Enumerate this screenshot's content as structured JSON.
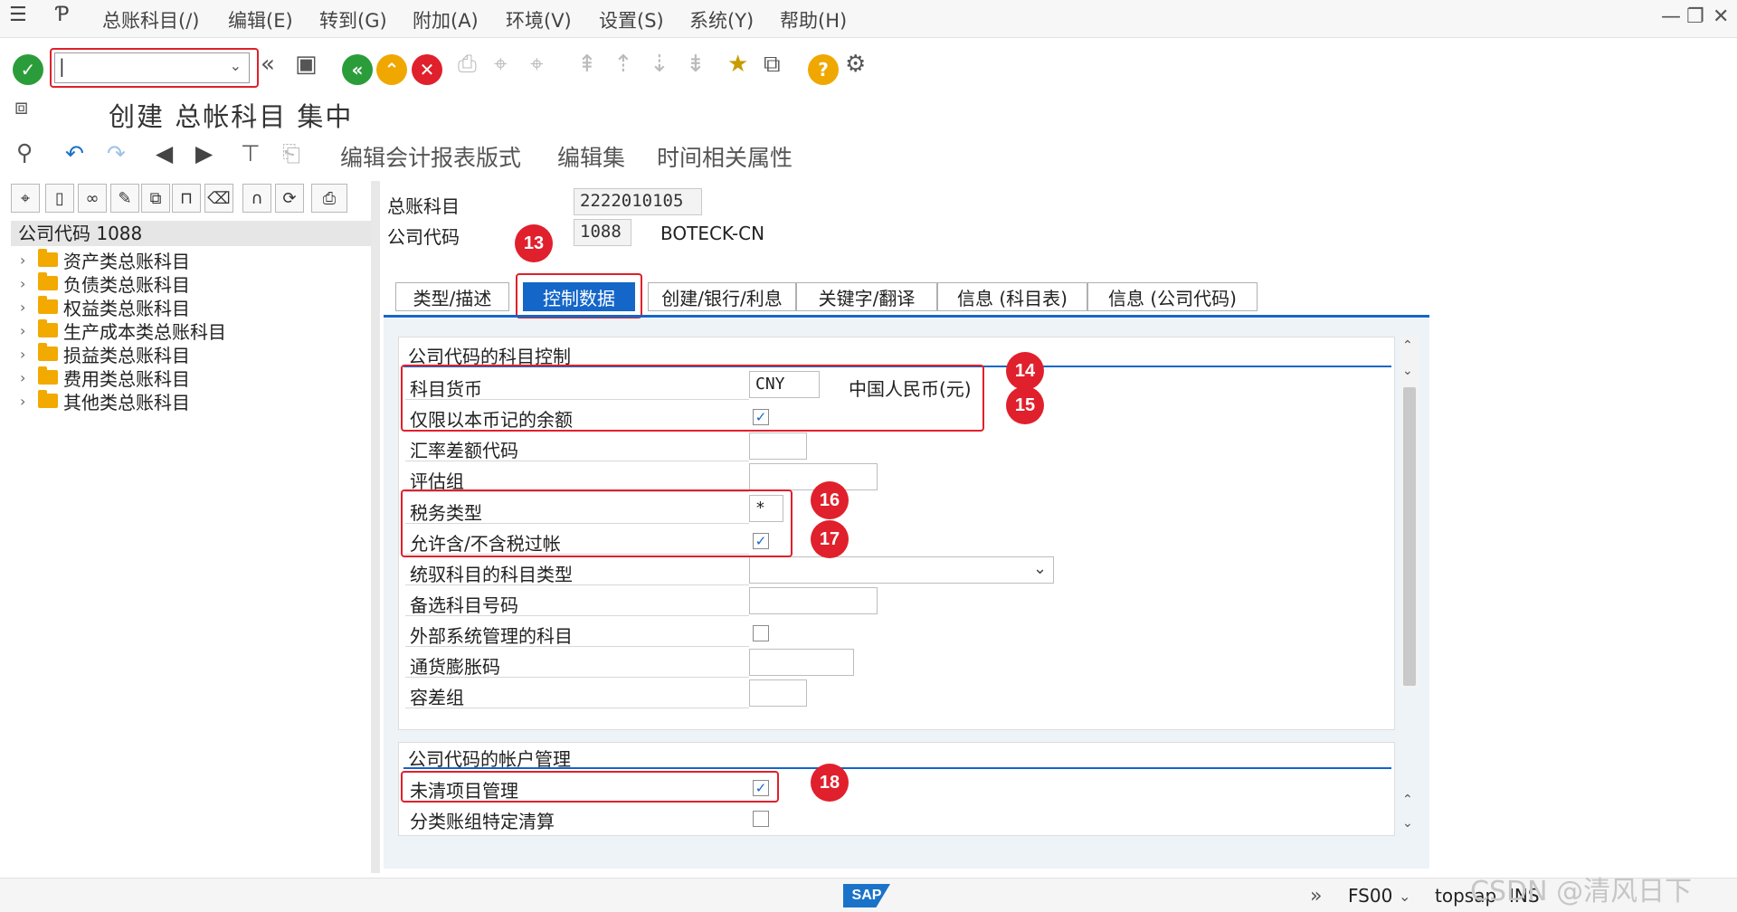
{
  "menubar": {
    "items": [
      "总账科目(/)",
      "编辑(E)",
      "转到(G)",
      "附加(A)",
      "环境(V)",
      "设置(S)",
      "系统(Y)",
      "帮助(H)"
    ]
  },
  "title": "创建 总帐科目 集中",
  "app_toolbar": {
    "buttons": [
      "编辑会计报表版式",
      "编辑集",
      "时间相关属性"
    ]
  },
  "tree": {
    "header": "公司代码 1088",
    "items": [
      "资产类总账科目",
      "负债类总账科目",
      "权益类总账科目",
      "生产成本类总账科目",
      "损益类总账科目",
      "费用类总账科目",
      "其他类总账科目"
    ]
  },
  "header_fields": {
    "gl_label": "总账科目",
    "gl_value": "2222010105",
    "cc_label": "公司代码",
    "cc_value": "1088",
    "cc_name": "BOTECK-CN"
  },
  "tabs": [
    "类型/描述",
    "控制数据",
    "创建/银行/利息",
    "关键字/翻译",
    "信息 (科目表)",
    "信息 (公司代码)"
  ],
  "section1": {
    "title": "公司代码的科目控制",
    "rows": [
      {
        "label": "科目货币",
        "value": "CNY",
        "extra": "中国人民币(元)"
      },
      {
        "label": "仅限以本币记的余额",
        "checked": true
      },
      {
        "label": "汇率差额代码",
        "value": ""
      },
      {
        "label": "评估组",
        "value": ""
      },
      {
        "label": "税务类型",
        "value": "*"
      },
      {
        "label": "允许含/不含税过帐",
        "checked": true
      },
      {
        "label": "统驭科目的科目类型",
        "value": ""
      },
      {
        "label": "备选科目号码",
        "value": ""
      },
      {
        "label": "外部系统管理的科目",
        "checked": false
      },
      {
        "label": "通货膨胀码",
        "value": ""
      },
      {
        "label": "容差组",
        "value": ""
      }
    ]
  },
  "section2": {
    "title": "公司代码的帐户管理",
    "rows": [
      {
        "label": "未清项目管理",
        "checked": true
      },
      {
        "label": "分类账组特定清算",
        "checked": false
      }
    ]
  },
  "badges": [
    "13",
    "14",
    "15",
    "16",
    "17",
    "18"
  ],
  "status": {
    "tcode": "FS00",
    "server": "topsap",
    "mode": "INS",
    "logo": "SAP"
  },
  "watermark": "CSDN @清风日下",
  "colors": {
    "accent": "#1466c8",
    "highlight": "#e0202c"
  }
}
